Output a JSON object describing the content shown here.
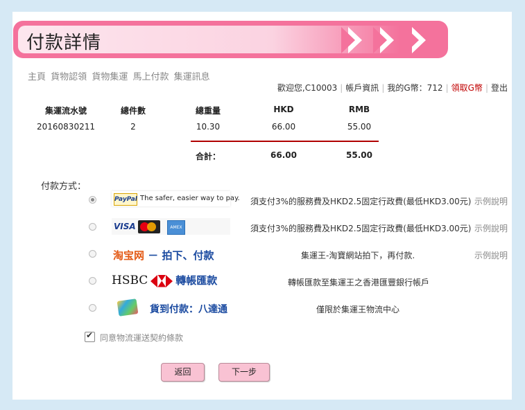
{
  "header": {
    "title": "付款詳情"
  },
  "nav": [
    "主頁",
    "貨物認領",
    "貨物集運",
    "馬上付款",
    "集運訊息"
  ],
  "userbar": {
    "welcome": "歡迎您,C10003",
    "account": "帳戶資訊",
    "coins": "我的G幣：712",
    "claim": "領取G幣",
    "logout": "登出"
  },
  "table": {
    "headers": [
      "集運流水號",
      "總件數",
      "總重量",
      "HKD",
      "RMB"
    ],
    "row": [
      "20160830211",
      "2",
      "10.30",
      "66.00",
      "55.00"
    ],
    "total_label": "合計：",
    "total_hkd": "66.00",
    "total_rmb": "55.00"
  },
  "payment": {
    "label": "付款方式：",
    "options": [
      {
        "logo_text": "The safer, easier way to pay.",
        "logo_brand": "PayPal",
        "desc": "須支付3%的服務費及HKD2.5固定行政費(最低HKD3.00元)",
        "example": "示例說明",
        "selected": true
      },
      {
        "logo_brand": "VISA",
        "amex": "AMEX",
        "desc": "須支付3%的服務費及HKD2.5固定行政費(最低HKD3.00元)",
        "example": "示例說明",
        "selected": false
      },
      {
        "logo_brand": "淘宝网",
        "logo_text": "－ 拍下、付款",
        "desc": "集運王-淘寶網站拍下，再付款.",
        "example": "示例說明",
        "selected": false
      },
      {
        "logo_brand": "HSBC",
        "logo_text": "轉帳匯款",
        "desc": "轉帳匯款至集運王之香港匯豐銀行帳戶",
        "selected": false
      },
      {
        "logo_text": "貨到付款：八達通",
        "desc": "僅限於集運王物流中心",
        "selected": false
      }
    ]
  },
  "agree": {
    "label": "同意物流運送契約條款",
    "checked": true
  },
  "buttons": {
    "back": "返回",
    "next": "下一步"
  },
  "colors": {
    "banner": "#f4729c",
    "button": "#f9c2d3",
    "accent_red": "#b00000",
    "page_bg": "#d6e9f5"
  }
}
